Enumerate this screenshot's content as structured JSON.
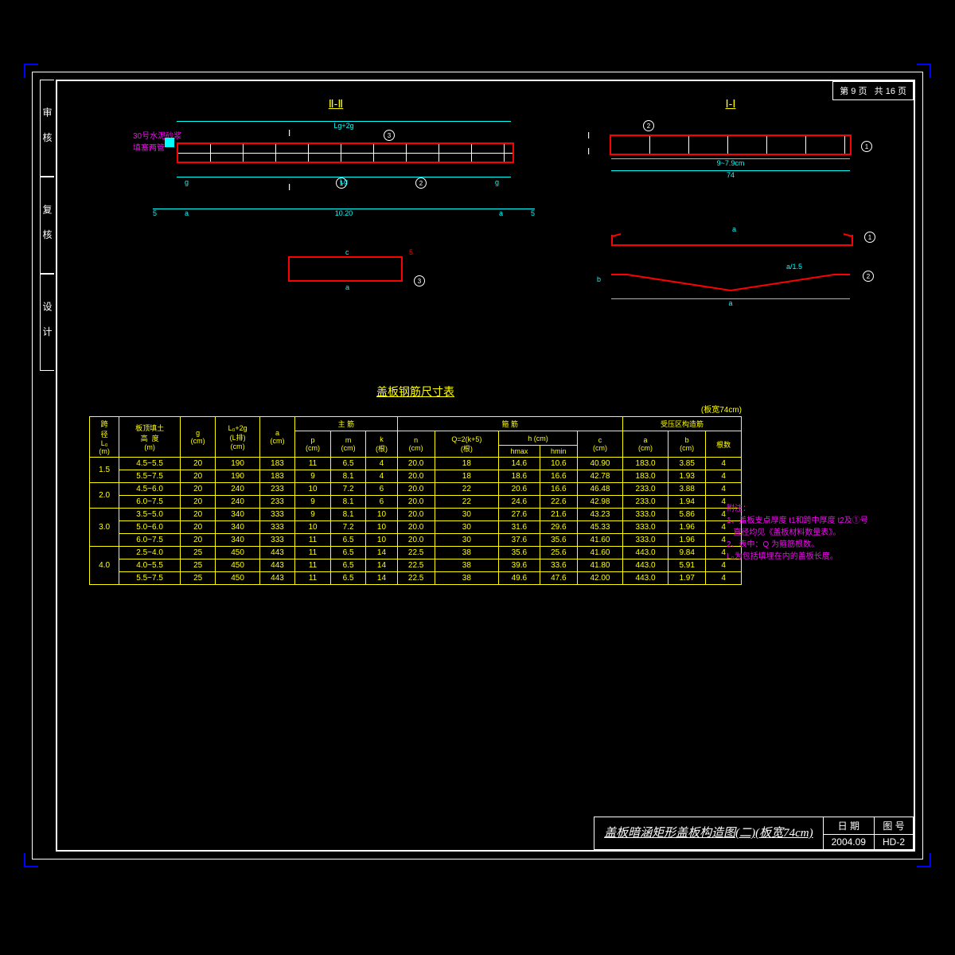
{
  "page_info": {
    "current": "第 9 页",
    "total": "共 16 页"
  },
  "side_labels": [
    "审 核",
    "复 核",
    "设 计"
  ],
  "section2": {
    "title": "Ⅱ-Ⅱ",
    "mortar_note": "30号水泥砂浆\n填塞两管",
    "top_dim": "Lg+2g",
    "marker_I": "Ⅰ",
    "dims_mid": [
      "g",
      "Lg",
      "g"
    ],
    "dim_bottom_left": "5",
    "dim_bottom_center": "10.20",
    "dim_bottom_right": "5",
    "dim_bottom_a": "a",
    "dim_bottom_g": "g",
    "callout1": "①",
    "callout2": "②",
    "callout3": "③",
    "circle5": "5",
    "small_c": "c",
    "small_a": "a",
    "small_call3": "③"
  },
  "section1": {
    "title": "Ⅰ-Ⅰ",
    "marker_I": "Ⅰ",
    "dim74": "74",
    "dim_spacing": "9~7.9cm",
    "callout1": "①",
    "callout2": "②",
    "red_a": "a",
    "red_a15": "a/1.5",
    "red_b": "b"
  },
  "table": {
    "title": "盖板钢筋尺寸表",
    "sub": "(板宽74cm)",
    "head_group1": "主  筋",
    "head_group2": "箍    筋",
    "head_group3": "受压区构造筋",
    "head_span": "跨\n径\nL₀\n(m)",
    "head_fill": "板顶填土\n高  度\n(m)",
    "head_g": "g\n(cm)",
    "head_lg2g": "L₀+2g\n(L排)\n(cm)",
    "head_a": "a\n(cm)",
    "head_p": "p\n(cm)",
    "head_m": "m\n(cm)",
    "head_k": "k\n(根)",
    "head_n": "n\n(cm)",
    "head_q": "Q=2(k+5)\n(根)",
    "head_h": "h  (cm)",
    "head_hmax": "hmax",
    "head_hmin": "hmin",
    "head_c": "c\n(cm)",
    "head_a2": "a\n(cm)",
    "head_b": "b\n(cm)",
    "head_count": "根数",
    "rows": [
      {
        "span": "1.5",
        "fill": "4.5~5.5",
        "g": "20",
        "lg": "190",
        "a": "183",
        "p": "11",
        "m": "6.5",
        "k": "4",
        "n": "20.0",
        "q": "18",
        "hmax": "14.6",
        "hmin": "10.6",
        "c": "40.90",
        "a2": "183.0",
        "b": "3.85",
        "cnt": "4"
      },
      {
        "span": "",
        "fill": "5.5~7.5",
        "g": "20",
        "lg": "190",
        "a": "183",
        "p": "9",
        "m": "8.1",
        "k": "4",
        "n": "20.0",
        "q": "18",
        "hmax": "18.6",
        "hmin": "16.6",
        "c": "42.78",
        "a2": "183.0",
        "b": "1.93",
        "cnt": "4"
      },
      {
        "span": "2.0",
        "fill": "4.5~6.0",
        "g": "20",
        "lg": "240",
        "a": "233",
        "p": "10",
        "m": "7.2",
        "k": "6",
        "n": "20.0",
        "q": "22",
        "hmax": "20.6",
        "hmin": "16.6",
        "c": "46.48",
        "a2": "233.0",
        "b": "3.88",
        "cnt": "4"
      },
      {
        "span": "",
        "fill": "6.0~7.5",
        "g": "20",
        "lg": "240",
        "a": "233",
        "p": "9",
        "m": "8.1",
        "k": "6",
        "n": "20.0",
        "q": "22",
        "hmax": "24.6",
        "hmin": "22.6",
        "c": "42.98",
        "a2": "233.0",
        "b": "1.94",
        "cnt": "4"
      },
      {
        "span": "3.0",
        "fill": "3.5~5.0",
        "g": "20",
        "lg": "340",
        "a": "333",
        "p": "9",
        "m": "8.1",
        "k": "10",
        "n": "20.0",
        "q": "30",
        "hmax": "27.6",
        "hmin": "21.6",
        "c": "43.23",
        "a2": "333.0",
        "b": "5.86",
        "cnt": "4"
      },
      {
        "span": "",
        "fill": "5.0~6.0",
        "g": "20",
        "lg": "340",
        "a": "333",
        "p": "10",
        "m": "7.2",
        "k": "10",
        "n": "20.0",
        "q": "30",
        "hmax": "31.6",
        "hmin": "29.6",
        "c": "45.33",
        "a2": "333.0",
        "b": "1.96",
        "cnt": "4"
      },
      {
        "span": "",
        "fill": "6.0~7.5",
        "g": "20",
        "lg": "340",
        "a": "333",
        "p": "11",
        "m": "6.5",
        "k": "10",
        "n": "20.0",
        "q": "30",
        "hmax": "37.6",
        "hmin": "35.6",
        "c": "41.60",
        "a2": "333.0",
        "b": "1.96",
        "cnt": "4"
      },
      {
        "span": "4.0",
        "fill": "2.5~4.0",
        "g": "25",
        "lg": "450",
        "a": "443",
        "p": "11",
        "m": "6.5",
        "k": "14",
        "n": "22.5",
        "q": "38",
        "hmax": "35.6",
        "hmin": "25.6",
        "c": "41.60",
        "a2": "443.0",
        "b": "9.84",
        "cnt": "4"
      },
      {
        "span": "",
        "fill": "4.0~5.5",
        "g": "25",
        "lg": "450",
        "a": "443",
        "p": "11",
        "m": "6.5",
        "k": "14",
        "n": "22.5",
        "q": "38",
        "hmax": "39.6",
        "hmin": "33.6",
        "c": "41.80",
        "a2": "443.0",
        "b": "5.91",
        "cnt": "4"
      },
      {
        "span": "",
        "fill": "5.5~7.5",
        "g": "25",
        "lg": "450",
        "a": "443",
        "p": "11",
        "m": "6.5",
        "k": "14",
        "n": "22.5",
        "q": "38",
        "hmax": "49.6",
        "hmin": "47.6",
        "c": "42.00",
        "a2": "443.0",
        "b": "1.97",
        "cnt": "4"
      }
    ]
  },
  "notes": {
    "head": "附注：",
    "n1": "1、盖板支点厚度 t1和跨中厚度 t2及①号\n   直径均见《盖板材料数量表》。",
    "n2": "2、表中：Q 为箍筋根数。",
    "n3": "   L₀为包括填埋在内的盖板长度。"
  },
  "titleblock": {
    "main": "盖板暗涵矩形盖板构造图(二)(板宽74cm)",
    "date_h": "日 期",
    "date_v": "2004.09",
    "no_h": "图  号",
    "no_v": "HD-2"
  }
}
